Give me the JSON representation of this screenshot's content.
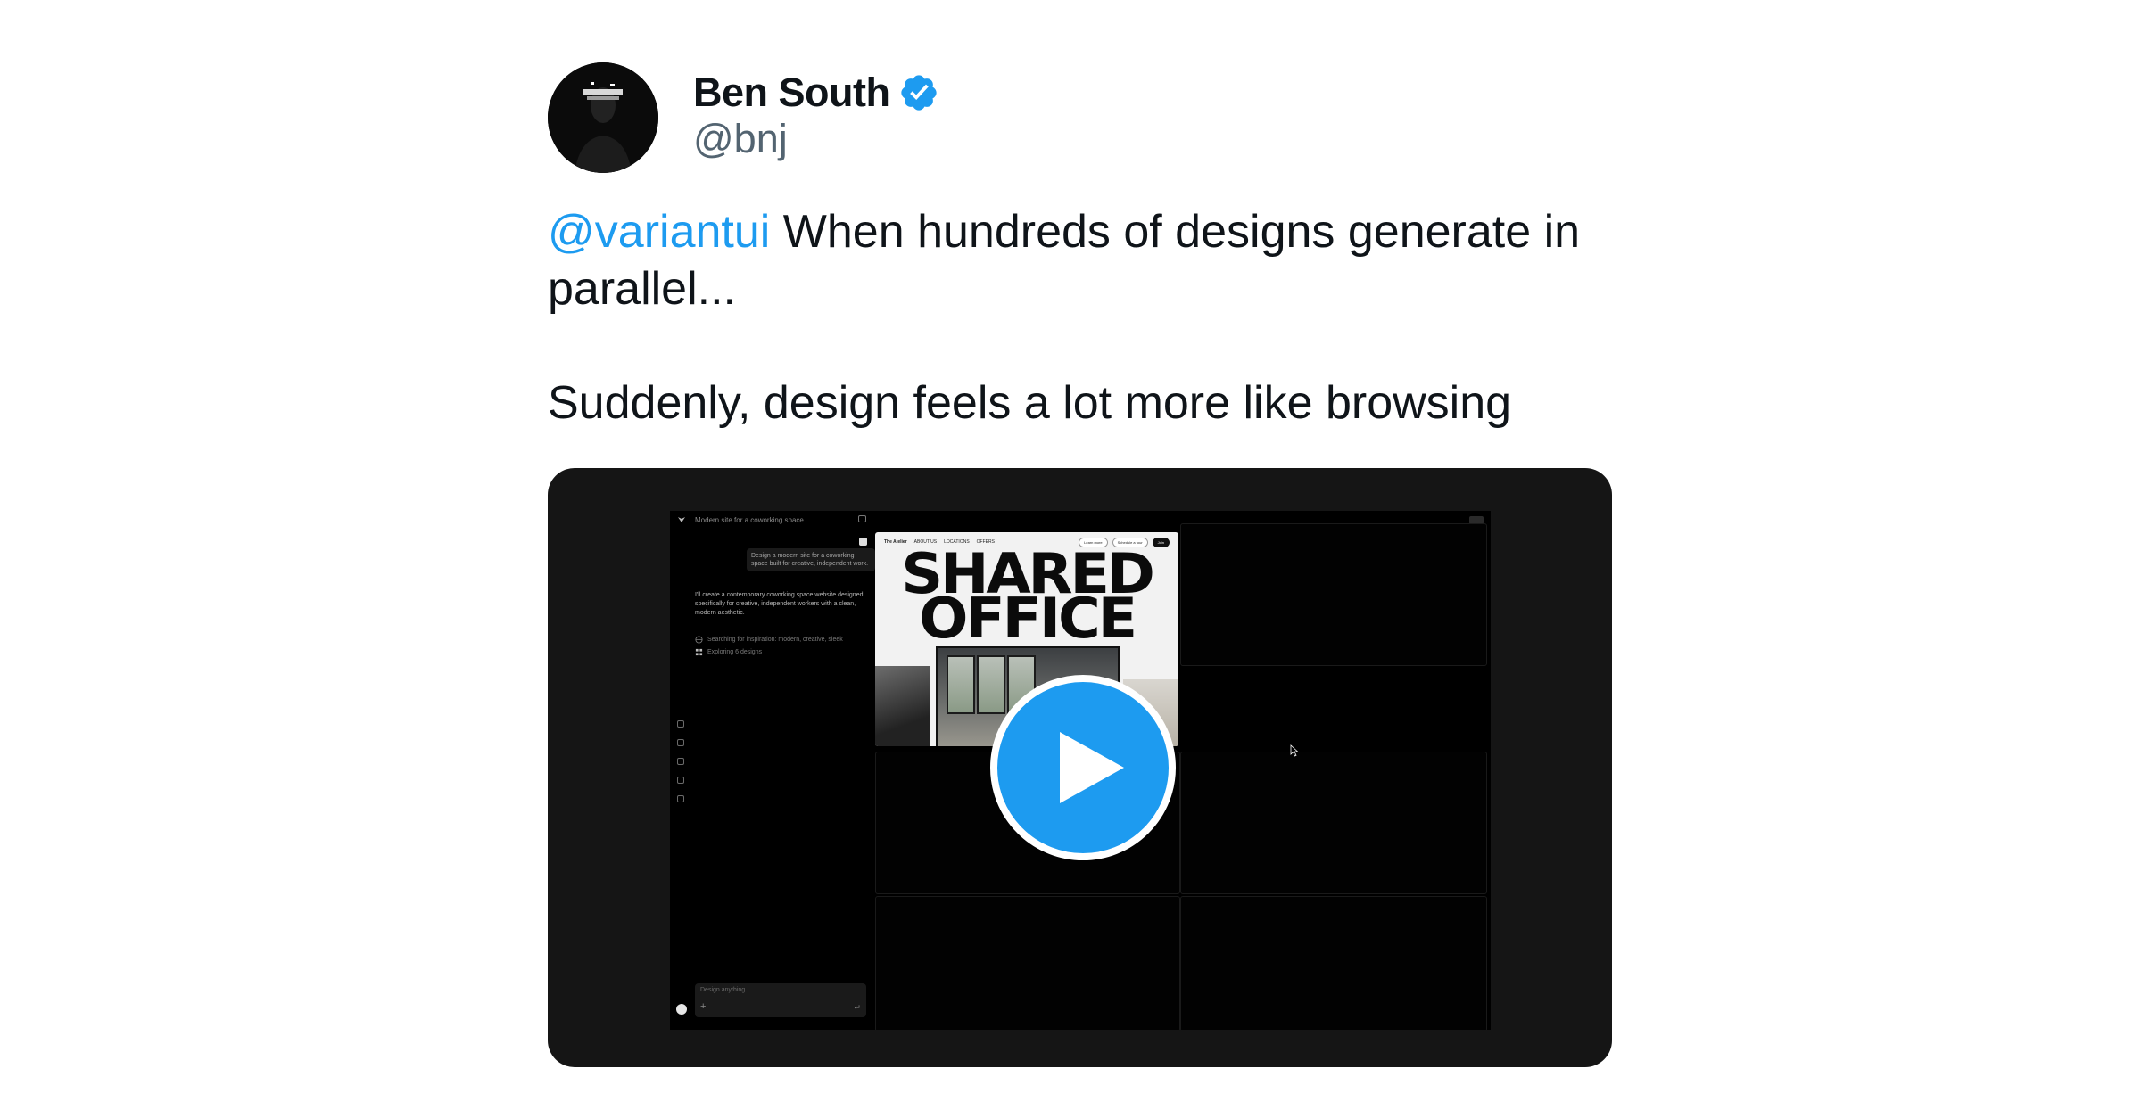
{
  "author": {
    "name": "Ben South",
    "handle": "@bnj",
    "verified_icon": "verified-badge-icon",
    "verified_color": "#1d9bf0"
  },
  "tweet": {
    "mention": "@variantui",
    "line1_rest": " When hundreds of designs generate in parallel...",
    "line2": "Suddenly, design feels a lot more like browsing"
  },
  "video": {
    "play_icon": "play-icon",
    "accent_color": "#1d9bf0",
    "screen": {
      "project_title": "Modern site for a coworking space",
      "user_prompt": "Design a modern site for a coworking space built for creative, independent work.",
      "assistant_reply": "I'll create a contemporary coworking space website designed specifically for creative, independent workers with a clean, modern aesthetic.",
      "status_items": [
        {
          "icon": "globe-icon",
          "text": "Searching for inspiration: modern, creative, sleek"
        },
        {
          "icon": "grid-icon",
          "text": "Exploring 6 designs"
        }
      ],
      "composer_placeholder": "Design anything...",
      "composer_plus": "+",
      "composer_enter": "↵",
      "preview": {
        "brand": "The Atelier",
        "nav": [
          "ABOUT US",
          "LOCATIONS",
          "OFFERS"
        ],
        "actions": [
          "Learn more",
          "Schedule a tour",
          "Join"
        ],
        "headline_line1": "SHARED",
        "headline_line2": "OFFICE"
      }
    }
  }
}
